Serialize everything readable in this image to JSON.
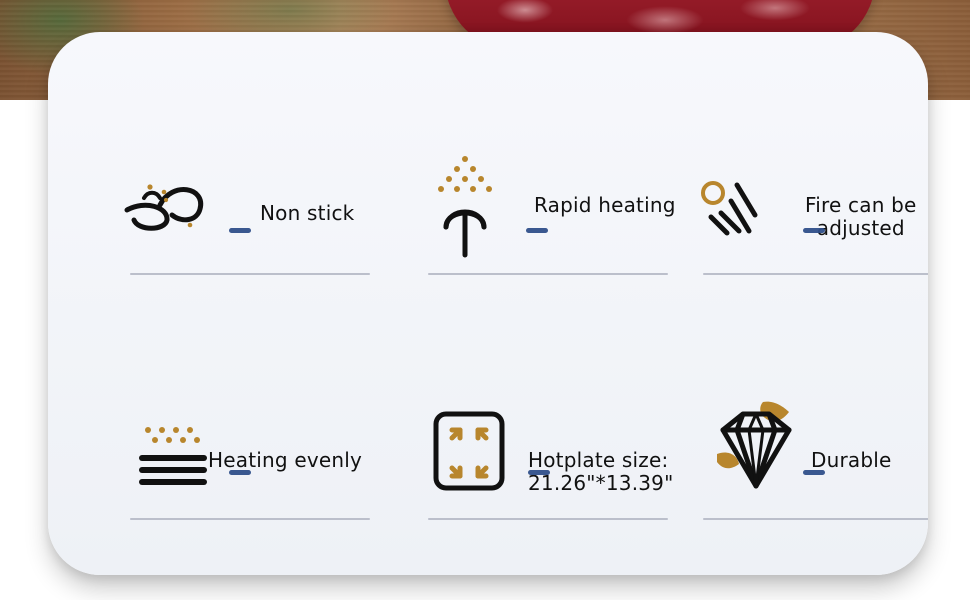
{
  "palette": {
    "icon_black": "#111111",
    "accent_gold": "#b8862d",
    "accent_blue": "#2f4f8a",
    "divider_gray": "#b7bcc8",
    "panel_bg": "#f3f5fa"
  },
  "features": [
    {
      "label_lines": [
        "Non stick"
      ],
      "icon": "non-stick-icon"
    },
    {
      "label_lines": [
        "Rapid heating"
      ],
      "icon": "rapid-heating-icon"
    },
    {
      "label_lines": [
        "Fire can be",
        "adjusted"
      ],
      "icon": "fire-adjust-icon"
    },
    {
      "label_lines": [
        "Heating evenly"
      ],
      "icon": "heating-evenly-icon"
    },
    {
      "label_lines": [
        "Hotplate size:",
        "21.26\"*13.39\""
      ],
      "icon": "hotplate-size-icon"
    },
    {
      "label_lines": [
        "Durable"
      ],
      "icon": "durable-icon"
    }
  ]
}
